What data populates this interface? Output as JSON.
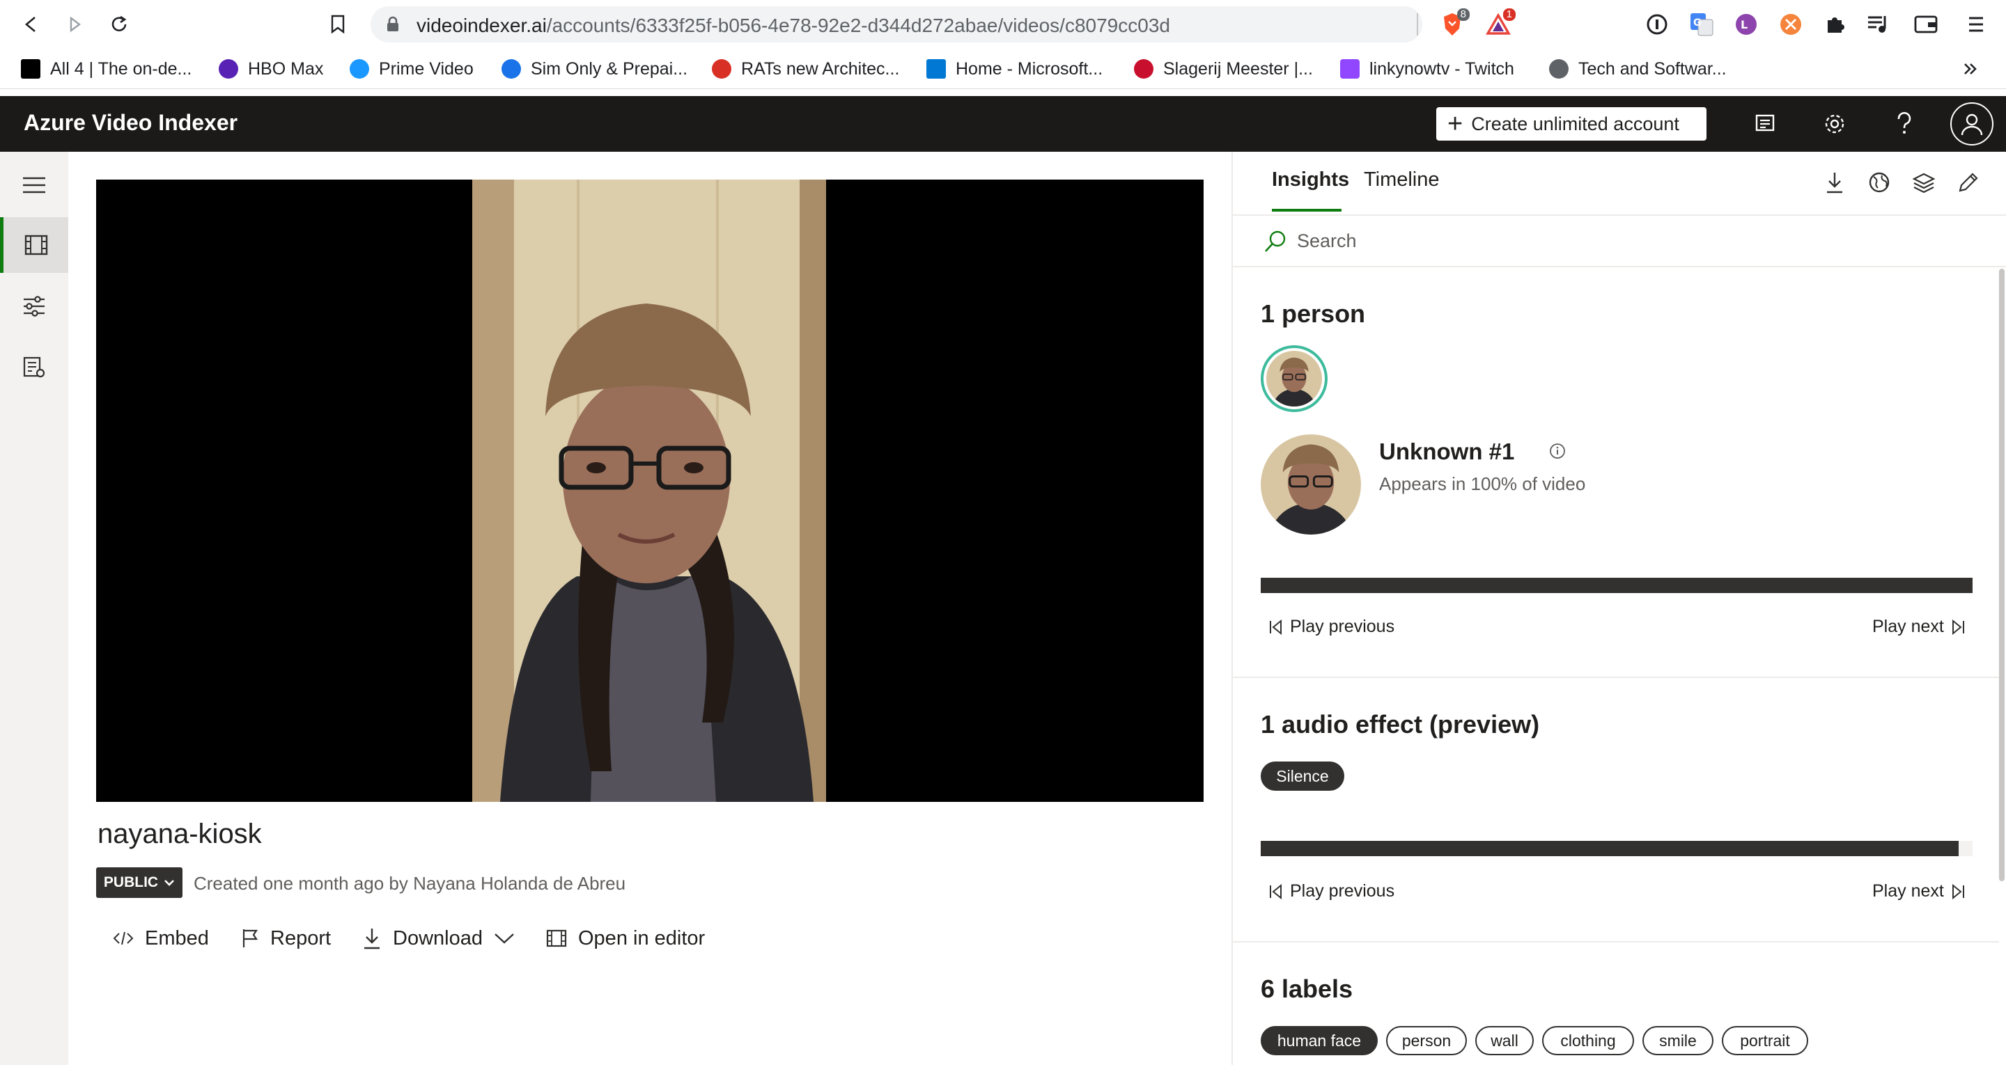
{
  "browser": {
    "url_host": "videoindexer.ai",
    "url_path": "/accounts/6333f25f-b056-4e78-92e2-d344d272abae/videos/c8079cc03d",
    "brave_badge": "8",
    "alert_badge": "1",
    "bookmarks": [
      {
        "label": "All 4 | The on-de...",
        "color": "#000000"
      },
      {
        "label": "HBO Max",
        "color": "#5822b4"
      },
      {
        "label": "Prime Video",
        "color": "#1a98ff"
      },
      {
        "label": "Sim Only & Prepai...",
        "color": "#1a73e8"
      },
      {
        "label": "RATs new Architec...",
        "color": "#d93025"
      },
      {
        "label": "Home - Microsoft...",
        "color": "#0078d4"
      },
      {
        "label": "Slagerij Meester |...",
        "color": "#c8102e"
      },
      {
        "label": "linkynowtv - Twitch",
        "color": "#9146ff"
      },
      {
        "label": "Tech and Softwar...",
        "color": "#5f6368"
      }
    ]
  },
  "app": {
    "title": "Azure Video Indexer",
    "create_button": "Create unlimited account"
  },
  "video": {
    "title": "nayana-kiosk",
    "visibility": "PUBLIC",
    "created": "Created one month ago by Nayana Holanda de Abreu"
  },
  "actions": {
    "embed": "Embed",
    "report": "Report",
    "download": "Download",
    "open_editor": "Open in editor"
  },
  "panel": {
    "tabs": [
      "Insights",
      "Timeline"
    ],
    "search_placeholder": "Search",
    "people": {
      "title": "1 person",
      "name": "Unknown #1",
      "appearance": "Appears in 100% of video",
      "appearance_fraction": 1.0,
      "play_previous": "Play previous",
      "play_next": "Play next"
    },
    "audio": {
      "title": "1 audio effect (preview)",
      "effect": "Silence",
      "fraction": 0.98,
      "play_previous": "Play previous",
      "play_next": "Play next"
    },
    "labels": {
      "title": "6 labels",
      "items": [
        "human face",
        "person",
        "wall",
        "clothing",
        "smile",
        "portrait"
      ]
    }
  },
  "colors": {
    "header_bg": "#1b1a19",
    "accent": "#107c10",
    "avatar_ring": "#3dbb9c",
    "bar": "#323130"
  }
}
